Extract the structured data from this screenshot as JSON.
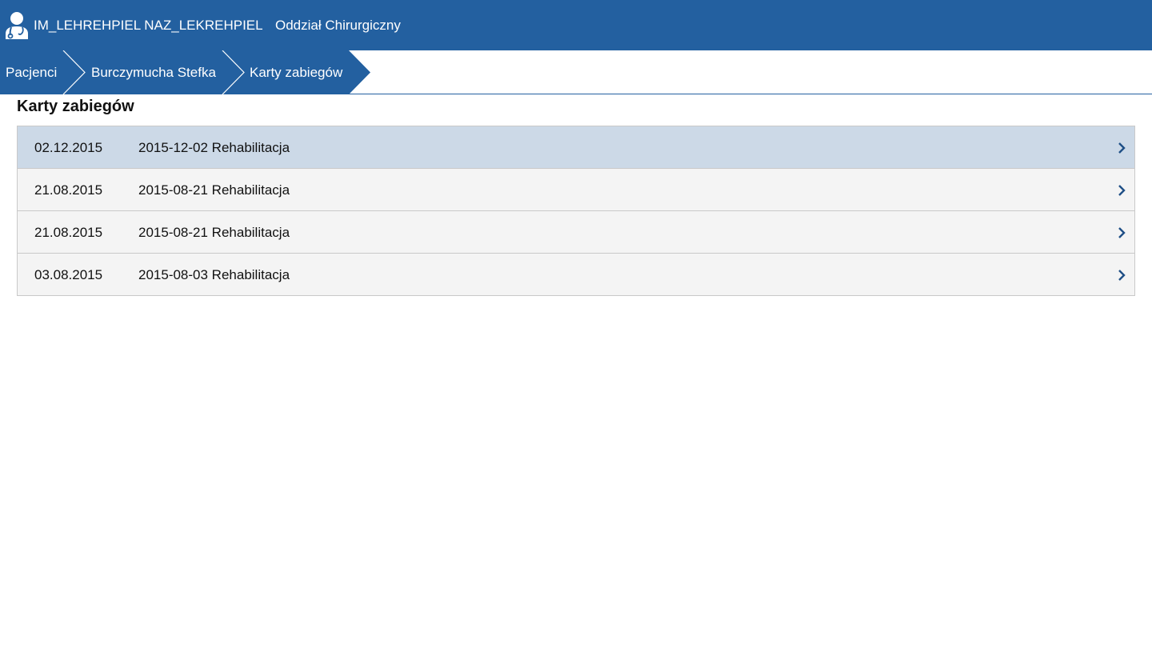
{
  "header": {
    "user_name": "IM_LEHREHPIEL NAZ_LEKREHPIEL",
    "department": "Oddział Chirurgiczny",
    "icon": "doctor-avatar-icon",
    "color": "#2360a0"
  },
  "breadcrumb": {
    "items": [
      {
        "label": "Pacjenci"
      },
      {
        "label": "Burczymucha Stefka"
      },
      {
        "label": "Karty zabiegów"
      }
    ]
  },
  "page": {
    "title": "Karty zabiegów"
  },
  "list": {
    "selected_color": "#ccd9e7",
    "rows": [
      {
        "date": "02.12.2015",
        "description": "2015-12-02 Rehabilitacja",
        "selected": true
      },
      {
        "date": "21.08.2015",
        "description": "2015-08-21 Rehabilitacja",
        "selected": false
      },
      {
        "date": "21.08.2015",
        "description": "2015-08-21 Rehabilitacja",
        "selected": false
      },
      {
        "date": "03.08.2015",
        "description": "2015-08-03 Rehabilitacja",
        "selected": false
      }
    ]
  }
}
